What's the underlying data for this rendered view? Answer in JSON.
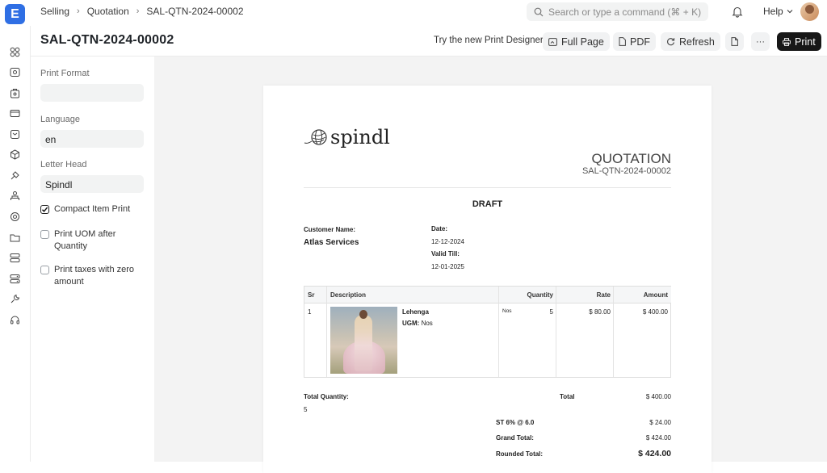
{
  "topbar": {
    "breadcrumbs": [
      "Selling",
      "Quotation",
      "SAL-QTN-2024-00002"
    ],
    "search_placeholder": "Search or type a command (⌘ + K)",
    "help_label": "Help"
  },
  "header": {
    "title": "SAL-QTN-2024-00002",
    "try_designer_label": "Try the new Print Designer",
    "full_page_label": "Full Page",
    "pdf_label": "PDF",
    "refresh_label": "Refresh",
    "more_label": "···",
    "print_label": "Print"
  },
  "sidebar_icons": [
    "modules-icon",
    "selling-icon",
    "buying-icon",
    "accounting-icon",
    "stock-icon",
    "assets-icon",
    "crm-icon",
    "hr-icon",
    "support-icon",
    "projects-icon",
    "integrations-icon",
    "settings-icon",
    "tools-icon",
    "headset-icon"
  ],
  "settings": {
    "print_format_label": "Print Format",
    "print_format_value": "",
    "language_label": "Language",
    "language_value": "en",
    "letter_head_label": "Letter Head",
    "letter_head_value": "Spindl",
    "checkboxes": [
      {
        "label": "Compact Item Print",
        "checked": true
      },
      {
        "label": "Print UOM after Quantity",
        "checked": false
      },
      {
        "label": "Print taxes with zero amount",
        "checked": false
      }
    ]
  },
  "document": {
    "brand": "spindl",
    "doc_title": "QUOTATION",
    "doc_id": "SAL-QTN-2024-00002",
    "status": "DRAFT",
    "customer_name_label": "Customer Name:",
    "customer_name": "Atlas Services",
    "date_label": "Date:",
    "date": "12-12-2024",
    "valid_till_label": "Valid Till:",
    "valid_till": "12-01-2025",
    "table": {
      "headers": [
        "Sr",
        "Description",
        "Quantity",
        "Rate",
        "Amount"
      ],
      "rows": [
        {
          "sr": "1",
          "item": "Lehenga",
          "uom_label": "UGM:",
          "uom": "Nos",
          "unit": "Nos",
          "qty": "5",
          "rate": "$ 80.00",
          "amount": "$ 400.00"
        }
      ]
    },
    "total_qty_label": "Total Quantity:",
    "total_qty": "5",
    "total_label": "Total",
    "total": "$ 400.00",
    "tax_label": "ST 6% @ 6.0",
    "tax": "$ 24.00",
    "grand_total_label": "Grand Total:",
    "grand_total": "$ 424.00",
    "rounded_total_label": "Rounded Total:",
    "rounded_total": "$ 424.00"
  }
}
